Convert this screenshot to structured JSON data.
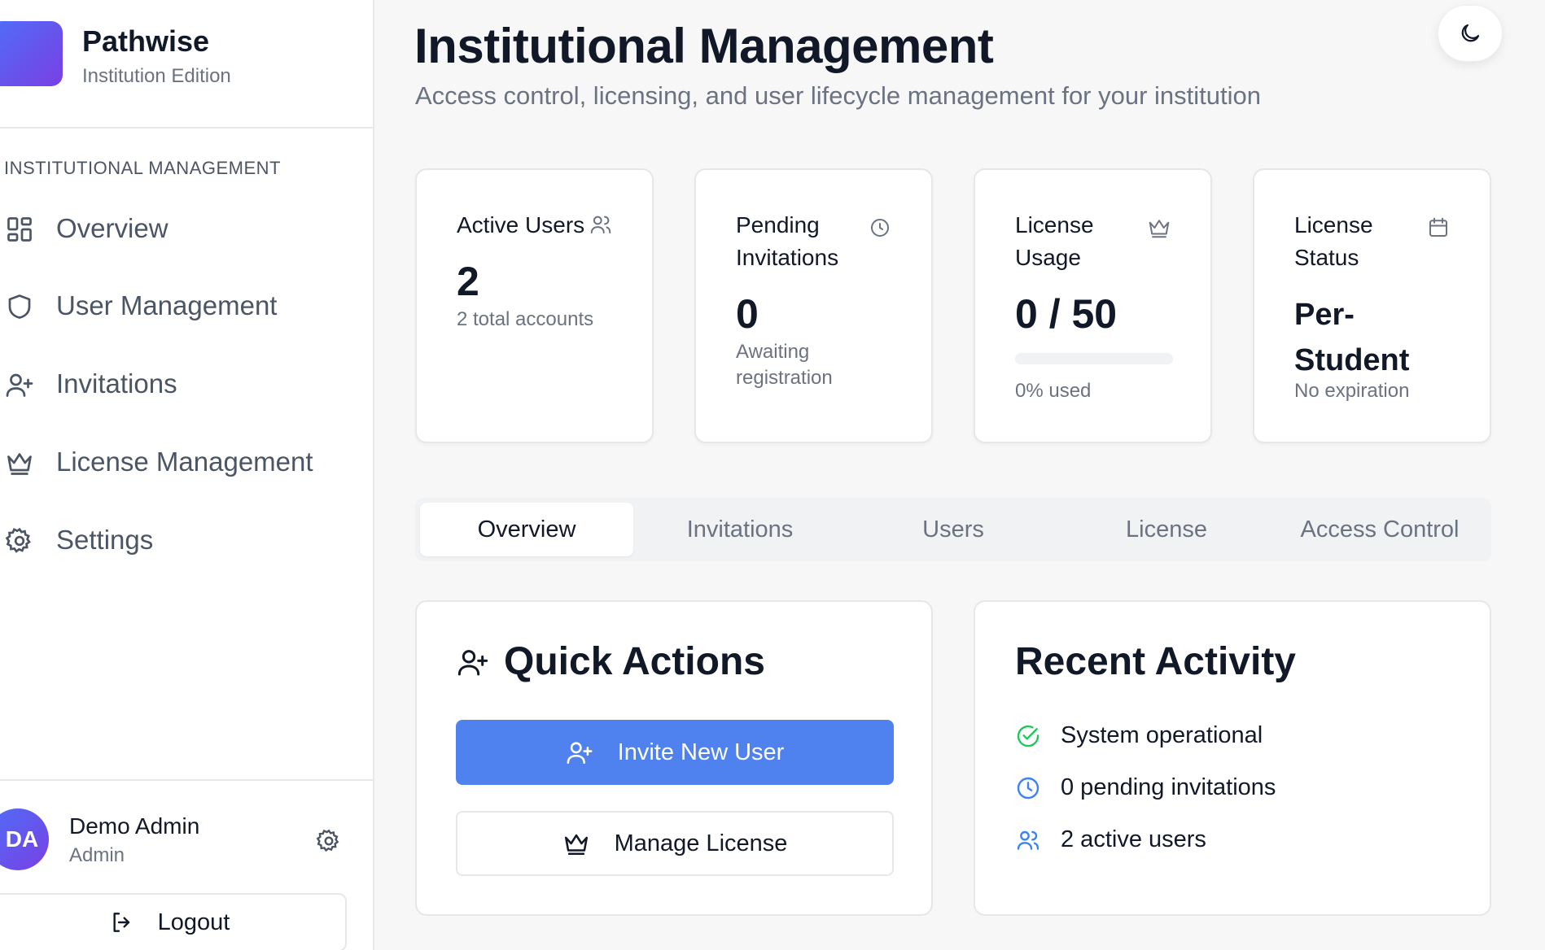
{
  "brand": {
    "name": "Pathwise",
    "subtitle": "Institution Edition"
  },
  "sidebar": {
    "section_label": "INSTITUTIONAL MANAGEMENT",
    "items": [
      {
        "label": "Overview",
        "icon": "grid-icon"
      },
      {
        "label": "User Management",
        "icon": "shield-icon"
      },
      {
        "label": "Invitations",
        "icon": "user-plus-icon"
      },
      {
        "label": "License Management",
        "icon": "crown-icon"
      },
      {
        "label": "Settings",
        "icon": "gear-icon"
      }
    ],
    "user": {
      "initials": "DA",
      "name": "Demo Admin",
      "role": "Admin"
    },
    "logout_label": "Logout"
  },
  "header": {
    "title": "Institutional Management",
    "subtitle": "Access control, licensing, and user lifecycle management for your institution",
    "theme_toggle_icon": "moon-icon"
  },
  "stats": [
    {
      "title": "Active Users",
      "value": "2",
      "note": "2 total accounts",
      "icon": "users-icon"
    },
    {
      "title": "Pending Invitations",
      "value": "0",
      "note": "Awaiting registration",
      "icon": "clock-icon"
    },
    {
      "title": "License Usage",
      "value": "0 / 50",
      "note": "0% used",
      "progress_percent": 0,
      "icon": "crown-icon"
    },
    {
      "title": "License Status",
      "value": "Per-Student",
      "note": "No expiration",
      "icon": "calendar-icon"
    }
  ],
  "tabs": [
    {
      "label": "Overview",
      "active": true
    },
    {
      "label": "Invitations",
      "active": false
    },
    {
      "label": "Users",
      "active": false
    },
    {
      "label": "License",
      "active": false
    },
    {
      "label": "Access Control",
      "active": false
    }
  ],
  "quick_actions": {
    "title": "Quick Actions",
    "primary_label": "Invite New User",
    "secondary_label": "Manage License"
  },
  "recent_activity": {
    "title": "Recent Activity",
    "items": [
      {
        "text": "System operational",
        "icon": "check-circle-icon",
        "color": "#22c55e"
      },
      {
        "text": "0 pending invitations",
        "icon": "clock-icon",
        "color": "#3b82f6"
      },
      {
        "text": "2 active users",
        "icon": "users-icon",
        "color": "#3b82f6"
      }
    ]
  },
  "colors": {
    "primary": "#4f81ef",
    "brand_gradient_start": "#4f6ef7",
    "brand_gradient_end": "#7a3fe4"
  }
}
